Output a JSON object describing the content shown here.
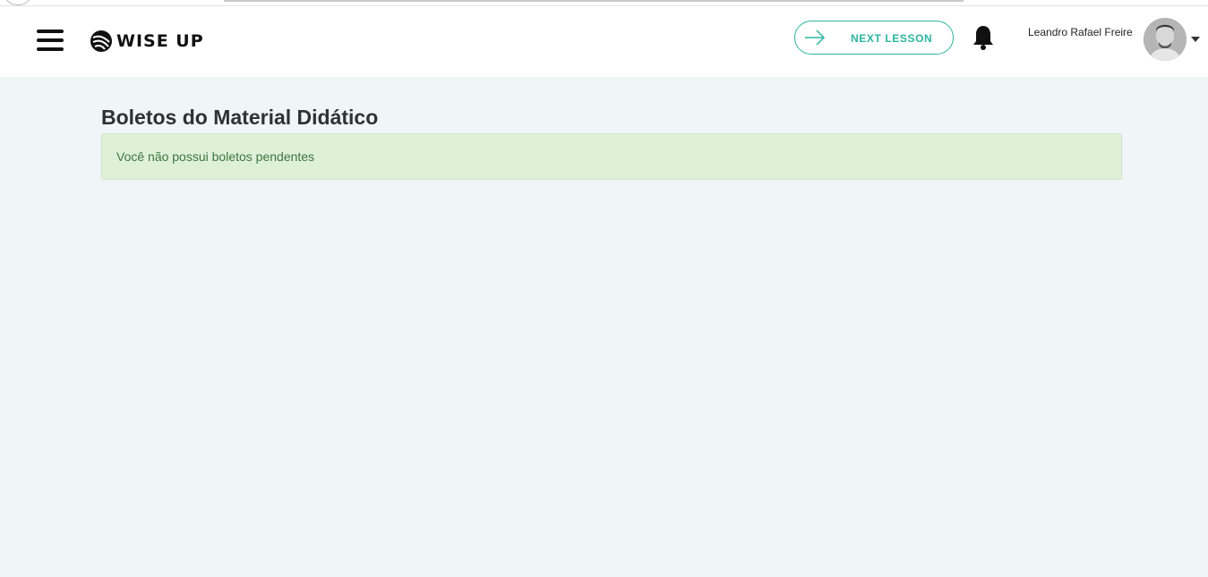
{
  "header": {
    "logo_text": "WISE UP",
    "next_lesson_label": "NEXT LESSON",
    "user_name": "Leandro Rafael Freire"
  },
  "main": {
    "title": "Boletos do Material Didático",
    "alert_message": "Você não possui boletos pendentes"
  },
  "colors": {
    "accent": "#2cb5a0",
    "page_background": "#f0f5f8",
    "alert_background": "#dff0d8",
    "alert_text": "#3c763d"
  },
  "icons": [
    "menu-icon",
    "wise-up-logo-icon",
    "arrow-right-icon",
    "bell-icon",
    "chevron-down-icon"
  ]
}
